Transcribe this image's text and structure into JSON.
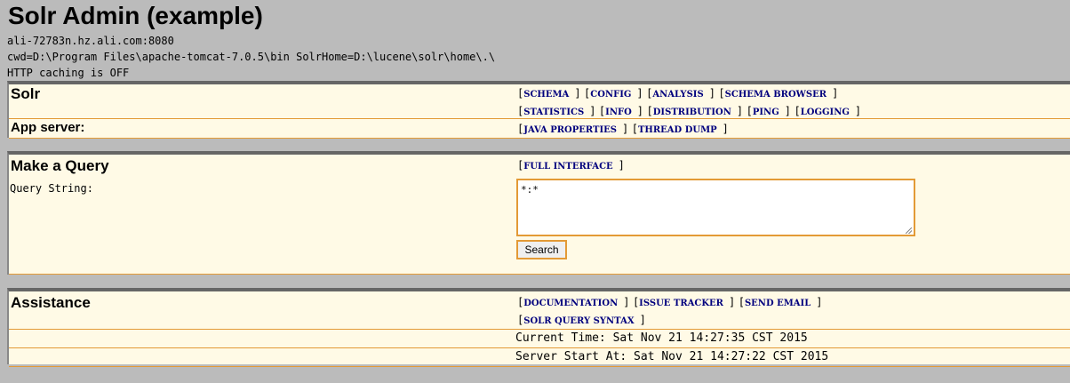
{
  "page": {
    "title": "Solr Admin (example)",
    "host": "ali-72783n.hz.ali.com:8080",
    "cwd": "cwd=D:\\Program Files\\apache-tomcat-7.0.5\\bin SolrHome=D:\\lucene\\solr\\home\\.\\",
    "caching": "HTTP caching is OFF"
  },
  "solr": {
    "label": "Solr",
    "links_row1": [
      "SCHEMA",
      "CONFIG",
      "ANALYSIS",
      "SCHEMA BROWSER"
    ],
    "links_row2": [
      "STATISTICS",
      "INFO",
      "DISTRIBUTION",
      "PING",
      "LOGGING"
    ]
  },
  "app_server": {
    "label": "App server:",
    "links": [
      "JAVA PROPERTIES",
      "THREAD DUMP"
    ]
  },
  "query": {
    "label": "Make a Query",
    "full_interface": "FULL INTERFACE",
    "query_string_label": "Query String:",
    "query_value": "*:*",
    "search_label": "Search"
  },
  "assistance": {
    "label": "Assistance",
    "links_row1": [
      "DOCUMENTATION",
      "ISSUE TRACKER",
      "SEND EMAIL"
    ],
    "links_row2": [
      "SOLR QUERY SYNTAX"
    ],
    "current_time": "Current Time: Sat Nov 21 14:27:35 CST 2015",
    "server_start": "Server Start At: Sat Nov 21 14:27:22 CST 2015"
  },
  "colors": {
    "background": "#bbbbbb",
    "section": "#fffae6",
    "accent": "#e39a36",
    "link": "#00007e"
  }
}
